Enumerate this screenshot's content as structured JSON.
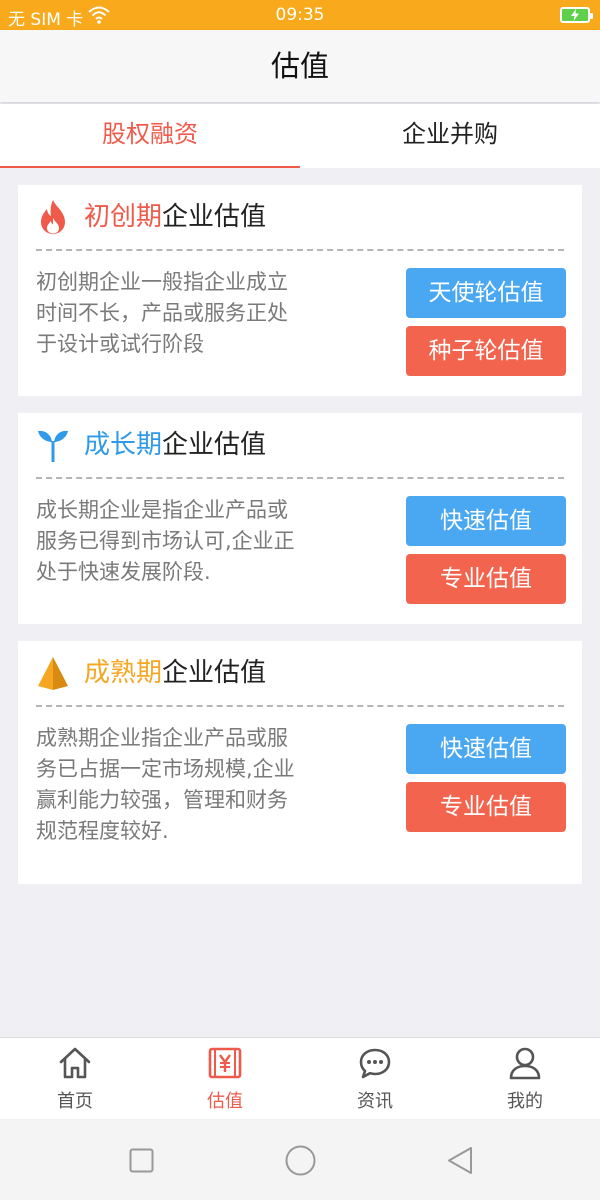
{
  "status": {
    "carrier": "无 SIM 卡",
    "time": "09:35"
  },
  "header": {
    "title": "估值"
  },
  "tabs": [
    {
      "label": "股权融资",
      "active": true
    },
    {
      "label": "企业并购",
      "active": false
    }
  ],
  "cards": [
    {
      "stage": "初创期",
      "suffix": "企业估值",
      "accent": "#f05a4a",
      "desc": [
        "初创期企业一般指企业成立",
        "时间不长，产品或服务正处",
        "于设计或试行阶段"
      ],
      "buttons": [
        "天使轮估值",
        "种子轮估值"
      ]
    },
    {
      "stage": "成长期",
      "suffix": "企业估值",
      "accent": "#2f9ae8",
      "desc": [
        "成长期企业是指企业产品或",
        "服务已得到市场认可,企业正",
        "处于快速发展阶段."
      ],
      "buttons": [
        "快速估值",
        "专业估值"
      ]
    },
    {
      "stage": "成熟期",
      "suffix": "企业估值",
      "accent": "#f5a623",
      "desc": [
        "成熟期企业指企业产品或服",
        "务已占据一定市场规模,企业",
        "赢利能力较强，管理和财务",
        "规范程度较好."
      ],
      "buttons": [
        "快速估值",
        "专业估值"
      ]
    }
  ],
  "tabbar": [
    {
      "label": "首页",
      "icon": "home-icon",
      "active": false
    },
    {
      "label": "估值",
      "icon": "yen-calculator-icon",
      "active": true
    },
    {
      "label": "资讯",
      "icon": "chat-bubble-icon",
      "active": false
    },
    {
      "label": "我的",
      "icon": "person-icon",
      "active": false
    }
  ],
  "colors": {
    "status_bar": "#f8a91c",
    "active": "#f05a4a",
    "blue_button": "#4aa7f2",
    "red_button": "#f2644d",
    "inactive_tab": "#555555"
  }
}
